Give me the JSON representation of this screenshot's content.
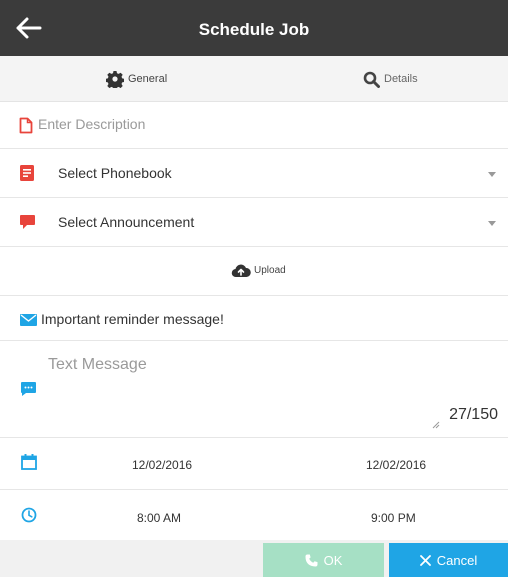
{
  "header": {
    "title": "Schedule Job",
    "back_icon": "arrow-left-icon"
  },
  "tabs": [
    {
      "label": "General",
      "icon": "gear-icon"
    },
    {
      "label": "Details",
      "icon": "search-icon"
    }
  ],
  "form": {
    "description_placeholder": "Enter Description",
    "phonebook": {
      "selected": "Select Phonebook",
      "icon": "document-list-icon"
    },
    "announcement": {
      "selected": "Select Announcement",
      "icon": "speech-bubble-icon"
    },
    "upload_label": "Upload",
    "subject": "Important reminder message!",
    "text_message_placeholder": "Text Message",
    "char_counter": "27/150",
    "start_date": "12/02/2016",
    "end_date": "12/02/2016",
    "start_time": "8:00 AM",
    "end_time": "9:00 PM"
  },
  "footer": {
    "ok_label": "OK",
    "cancel_label": "Cancel"
  },
  "colors": {
    "header": "#3b3b3b",
    "red_icon": "#e8443b",
    "blue_icon": "#1fa5e5",
    "ok_button": "#a6e0c5",
    "cancel_button": "#1fa5e5"
  }
}
